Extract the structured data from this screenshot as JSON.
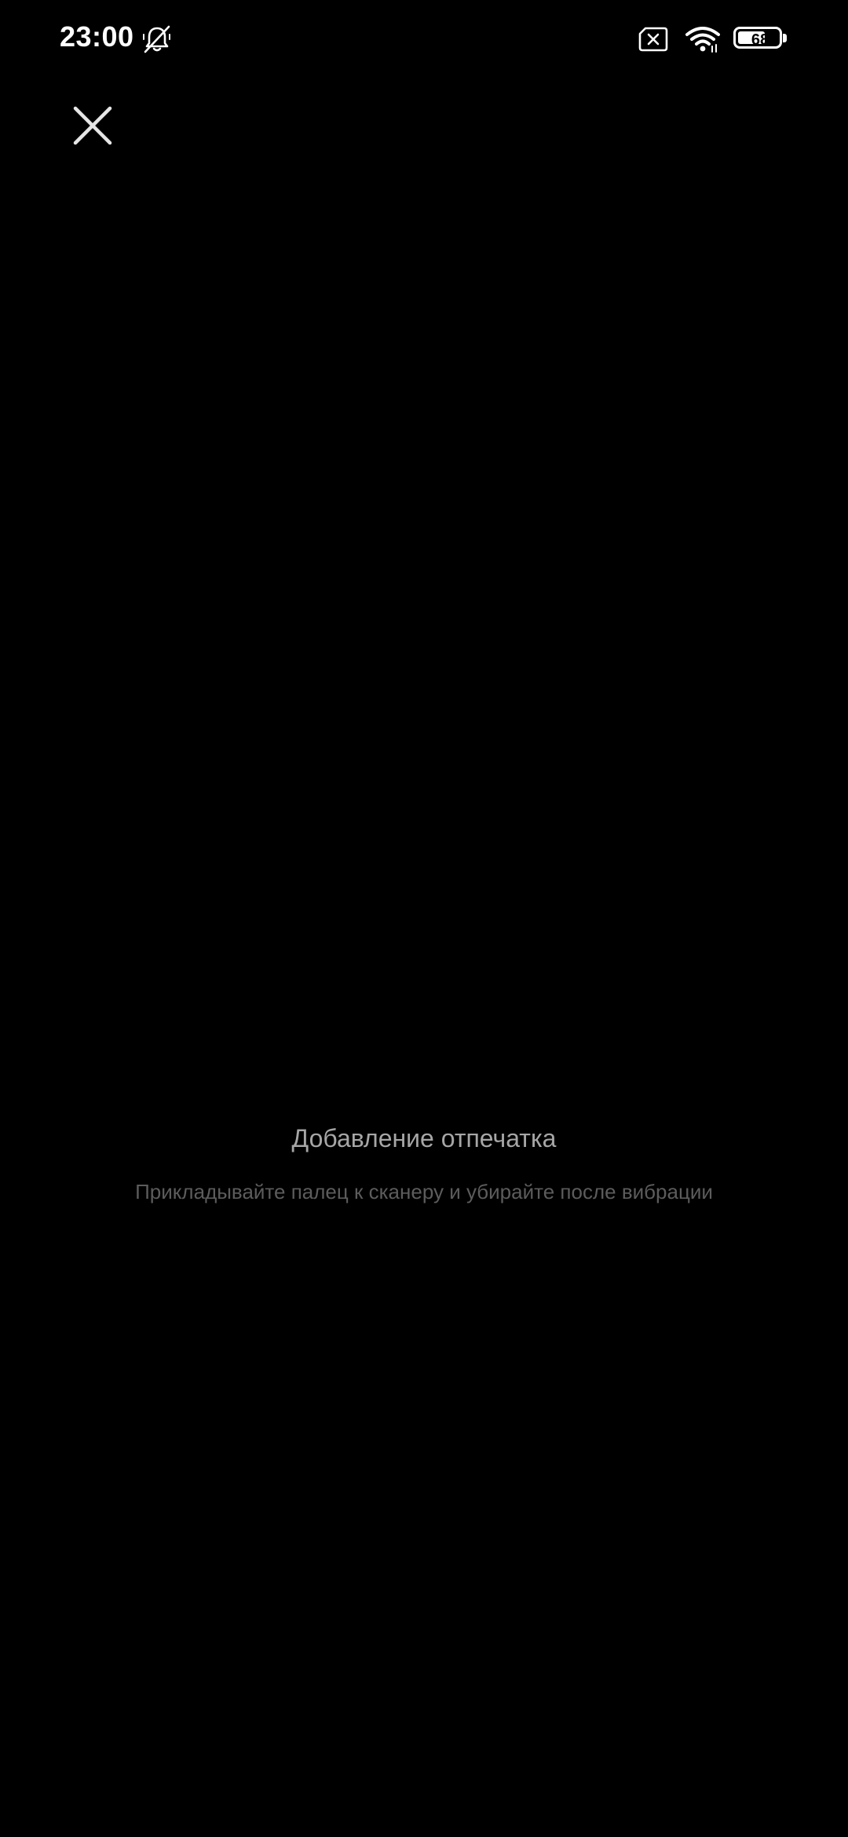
{
  "status_bar": {
    "time": "23:00",
    "battery_level": "68",
    "battery_fraction": 0.68,
    "icons": [
      "notifications-muted-icon",
      "sim-missing-icon",
      "wifi-icon",
      "battery-icon"
    ]
  },
  "toolbar": {
    "close_icon": "close-icon"
  },
  "enrollment": {
    "title": "Добавление отпечатка",
    "hint": "Прикладывайте палец к сканеру и убирайте после вибрации"
  },
  "colors": {
    "background": "#000000",
    "title_text": "#a6a6a6",
    "hint_text": "#5c5c5c",
    "icon": "#ffffff"
  }
}
